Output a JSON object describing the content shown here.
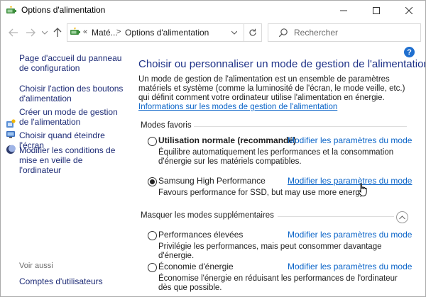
{
  "window": {
    "title": "Options d'alimentation"
  },
  "address": {
    "overflow": "«",
    "crumb1": "Maté...",
    "crumb2": "Options d'alimentation"
  },
  "search": {
    "placeholder": "Rechercher"
  },
  "left_nav": {
    "items": [
      "Page d'accueil du panneau de configuration",
      "Choisir l'action des boutons d'alimentation",
      "Créer un mode de gestion de l'alimentation",
      "Choisir quand éteindre l'écran",
      "Modifier les conditions de mise en veille de l'ordinateur"
    ],
    "see_also_label": "Voir aussi",
    "see_also_items": [
      "Comptes d'utilisateurs"
    ]
  },
  "main": {
    "help_label": "?",
    "heading": "Choisir ou personnaliser un mode de gestion de l'alimentation",
    "intro_text": "Un mode de gestion de l'alimentation est un ensemble de paramètres matériels et système (comme la luminosité de l'écran, le mode veille, etc.) qui définit comment votre ordinateur utilise l'alimentation en énergie. ",
    "intro_link": "Informations sur les modes de gestion de l'alimentation",
    "favorites_label": "Modes favoris",
    "hidden_label": "Masquer les modes supplémentaires",
    "plans": [
      {
        "name": "Utilisation normale (recommandé)",
        "link": "Modifier les paramètres du mode",
        "desc": "Équilibre automatiquement les performances et la consommation d'énergie sur les matériels compatibles.",
        "selected": false
      },
      {
        "name": "Samsung High Performance",
        "link": "Modifier les paramètres du mode",
        "desc": "Favours performance for SSD, but may use more energy",
        "selected": true
      },
      {
        "name": "Performances élevées",
        "link": "Modifier les paramètres du mode",
        "desc": "Privilégie les performances, mais peut consommer davantage d'énergie.",
        "selected": false
      },
      {
        "name": "Économie d'énergie",
        "link": "Modifier les paramètres du mode",
        "desc": "Économise l'énergie en réduisant les performances de l'ordinateur dès que possible.",
        "selected": false
      }
    ]
  },
  "colors": {
    "heading": "#1e3287",
    "link": "#0a64c8",
    "nav_link": "#1c2a75",
    "help_badge": "#1f6fcf"
  }
}
